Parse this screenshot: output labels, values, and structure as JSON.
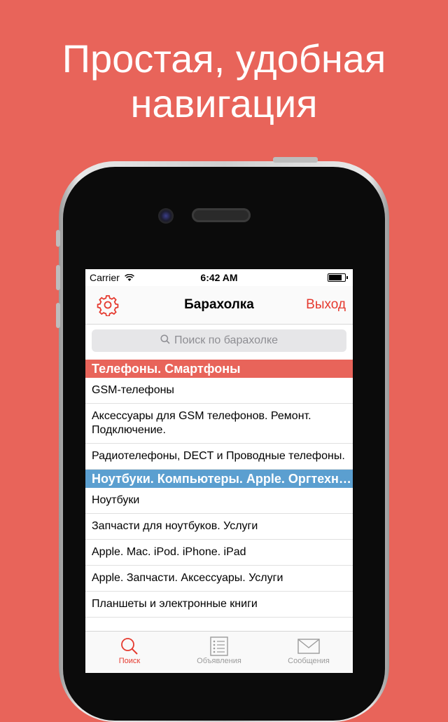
{
  "promo": {
    "line1": "Простая, удобная",
    "line2": "навигация"
  },
  "status_bar": {
    "carrier": "Carrier",
    "time": "6:42 AM"
  },
  "nav": {
    "title": "Барахолка",
    "logout_label": "Выход",
    "settings_icon": "gear-icon"
  },
  "search": {
    "placeholder": "Поиск по барахолке"
  },
  "sections": [
    {
      "title": "Телефоны. Смартфоны",
      "color": "#e8645a",
      "items": [
        "GSM-телефоны",
        "Аксессуары для GSM телефонов. Ремонт. Подключение.",
        "Радиотелефоны, DECT и Проводные телефоны."
      ]
    },
    {
      "title": "Ноутбуки. Компьютеры. Apple. Оргтехника",
      "color": "#5b9fd0",
      "items": [
        "Ноутбуки",
        "Запчасти для ноутбуков. Услуги",
        "Apple. Mac. iPod. iPhone. iPad",
        "Apple. Запчасти. Аксессуары. Услуги",
        "Планшеты и электронные книги"
      ]
    }
  ],
  "tabbar": {
    "tabs": [
      {
        "label": "Поиск",
        "icon": "search-icon",
        "active": true
      },
      {
        "label": "Объявления",
        "icon": "list-icon",
        "active": false
      },
      {
        "label": "Сообщения",
        "icon": "envelope-icon",
        "active": false
      }
    ]
  },
  "colors": {
    "background": "#e8645a",
    "accent": "#e53a2f",
    "section_blue": "#5b9fd0"
  }
}
